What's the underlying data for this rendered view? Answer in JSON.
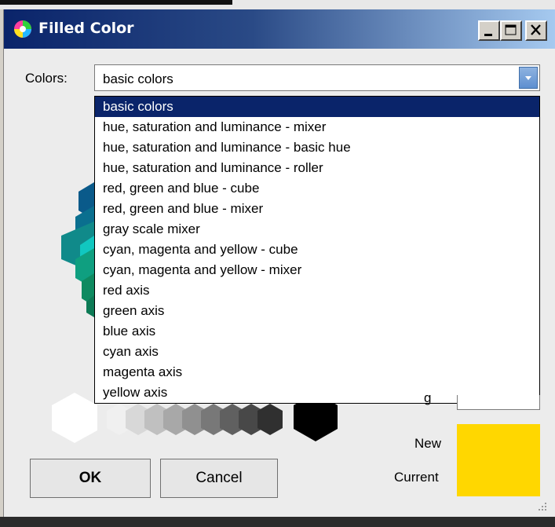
{
  "window": {
    "title": "Filled Color",
    "controls": [
      "minimize",
      "maximize",
      "close"
    ]
  },
  "colors": {
    "label": "Colors:",
    "selected": "basic colors",
    "options": [
      "basic colors",
      "hue, saturation and luminance - mixer",
      "hue, saturation and luminance - basic hue",
      "hue, saturation and luminance - roller",
      "red, green and blue - cube",
      "red, green and blue - mixer",
      "gray scale mixer",
      "cyan, magenta and yellow - cube",
      "cyan, magenta and yellow - mixer",
      "red axis",
      "green axis",
      "blue axis",
      "cyan axis",
      "magenta axis",
      "yellow axis"
    ]
  },
  "partial_label": "g",
  "preview": {
    "new_label": "New",
    "current_label": "Current",
    "new_color": "#ffd700",
    "current_color": "#ffd700"
  },
  "buttons": {
    "ok": "OK",
    "cancel": "Cancel"
  }
}
